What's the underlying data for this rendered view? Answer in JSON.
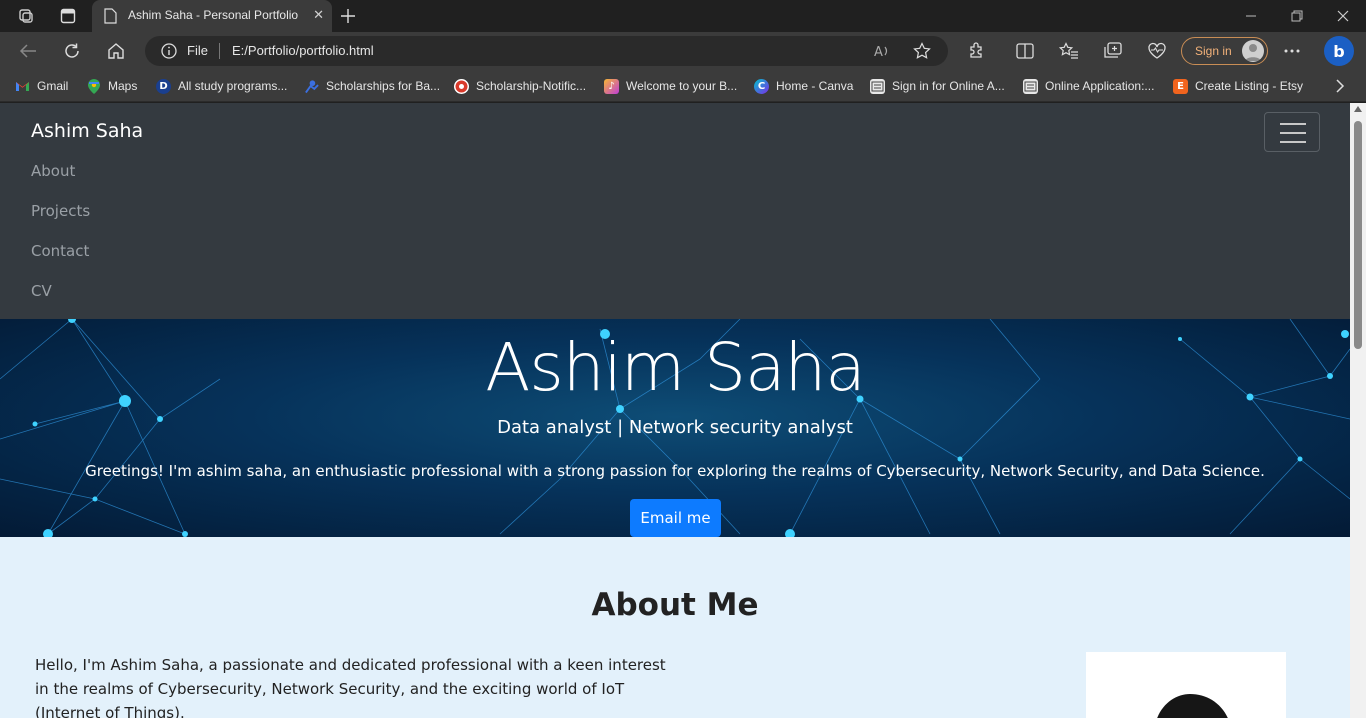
{
  "browser": {
    "tab": {
      "title": "Ashim Saha - Personal Portfolio"
    },
    "address": {
      "protocol": "File",
      "url": "E:/Portfolio/portfolio.html"
    },
    "signin_label": "Sign in",
    "bookmarks": [
      {
        "label": "Gmail",
        "icon": "gmail-icon",
        "color": "#ea4335"
      },
      {
        "label": "Maps",
        "icon": "maps-icon",
        "color": "#34a853"
      },
      {
        "label": "All study programs...",
        "icon": "daad-icon",
        "color": "#1a3f8f"
      },
      {
        "label": "Scholarships for Ba...",
        "icon": "scholarship-icon",
        "color": "#2b5fd9"
      },
      {
        "label": "Scholarship-Notific...",
        "icon": "notification-icon",
        "color": "#d93a2b"
      },
      {
        "label": "Welcome to your B...",
        "icon": "welcome-icon",
        "color": "#c03dd8"
      },
      {
        "label": "Home - Canva",
        "icon": "canva-icon",
        "color": "#7d2ae8"
      },
      {
        "label": "Sign in for Online A...",
        "icon": "form-icon",
        "color": "#dddddd"
      },
      {
        "label": "Online Application:...",
        "icon": "form-icon",
        "color": "#dddddd"
      },
      {
        "label": "Create Listing - Etsy",
        "icon": "etsy-icon",
        "color": "#f1641e"
      }
    ]
  },
  "page": {
    "navbar": {
      "brand": "Ashim Saha",
      "links": [
        "About",
        "Projects",
        "Contact",
        "CV"
      ]
    },
    "hero": {
      "title": "Ashim Saha",
      "subtitle": "Data analyst | Network security analyst",
      "text": "Greetings! I'm ashim saha, an enthusiastic professional with a strong passion for exploring the realms of Cybersecurity, Network Security, and Data Science.",
      "button": "Email me"
    },
    "about": {
      "title": "About Me",
      "text": "Hello, I'm Ashim Saha, a passionate and dedicated professional with a keen interest in the realms of Cybersecurity, Network Security, and the exciting world of IoT (Internet of Things)."
    }
  },
  "colors": {
    "navbar_bg": "#343a40",
    "button_primary": "#0d7bff",
    "about_bg": "#e3f1fb"
  }
}
